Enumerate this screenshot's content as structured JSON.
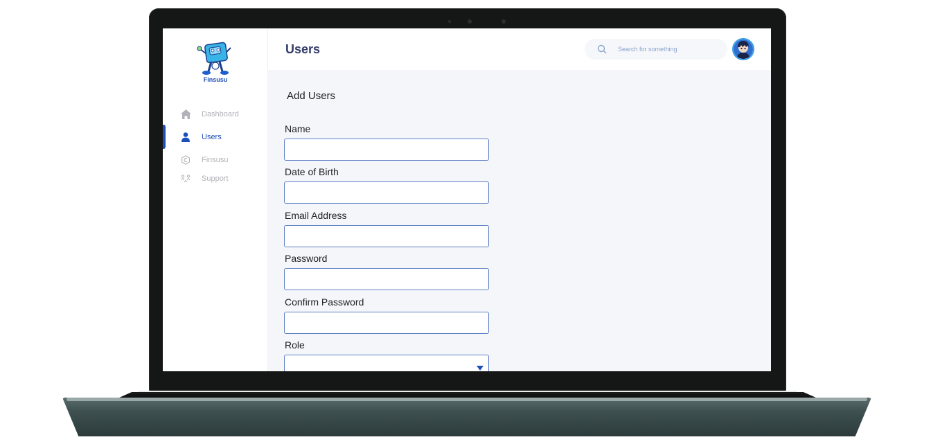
{
  "app": {
    "brand": "Finsusu"
  },
  "sidebar": {
    "items": [
      {
        "label": "Dashboard",
        "icon": "home-icon",
        "active": false
      },
      {
        "label": "Users",
        "icon": "user-icon",
        "active": true
      },
      {
        "label": "Finsusu",
        "icon": "finsusu-icon",
        "active": false
      },
      {
        "label": "Support",
        "icon": "support-icon",
        "active": false
      }
    ]
  },
  "header": {
    "title": "Users",
    "search_placeholder": "Search for something"
  },
  "form": {
    "title": "Add Users",
    "fields": [
      {
        "label": "Name",
        "value": ""
      },
      {
        "label": "Date of Birth",
        "value": ""
      },
      {
        "label": "Email Address",
        "value": ""
      },
      {
        "label": "Password",
        "value": ""
      },
      {
        "label": "Confirm Password",
        "value": ""
      },
      {
        "label": "Role",
        "value": ""
      }
    ]
  },
  "colors": {
    "accent": "#1d4fb8",
    "title": "#343c6a",
    "muted": "#b1b1b8",
    "background": "#f5f6fa",
    "input_border": "#5b7fc4"
  }
}
